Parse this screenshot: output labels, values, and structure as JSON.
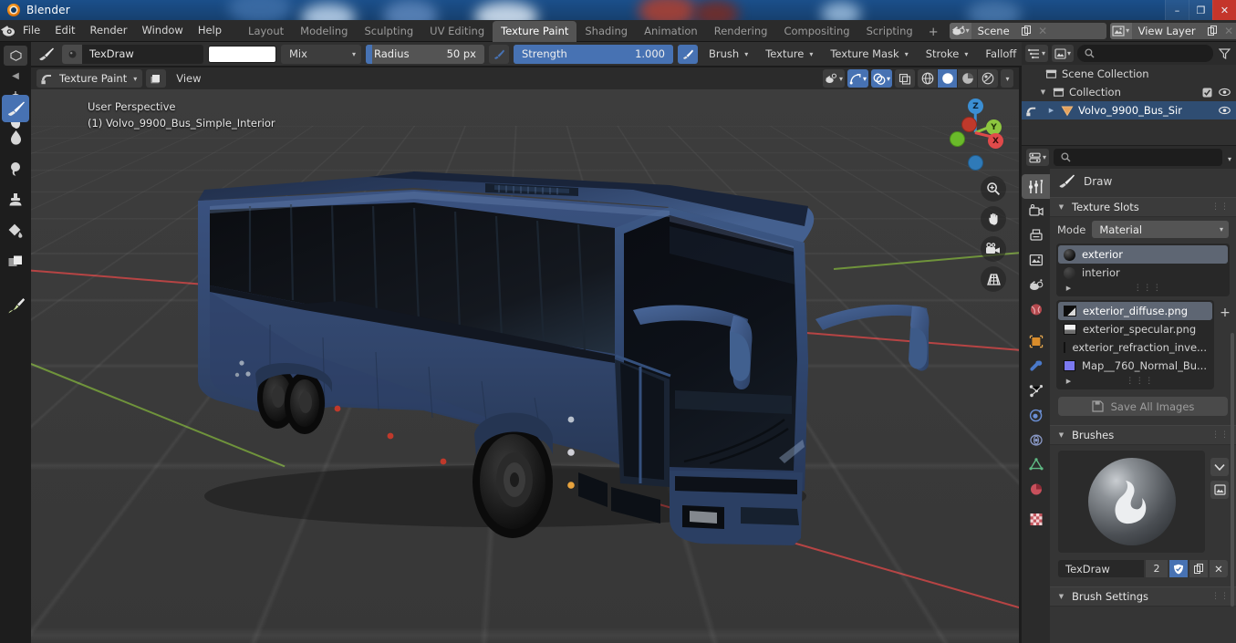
{
  "window": {
    "app_title": "Blender",
    "minimize": "–",
    "maximize": "❐",
    "close": "✕"
  },
  "topbar": {
    "logo_icon": "blender-logo-icon",
    "menus": [
      "File",
      "Edit",
      "Render",
      "Window",
      "Help"
    ],
    "workspaces": [
      {
        "label": "Layout",
        "active": false
      },
      {
        "label": "Modeling",
        "active": false
      },
      {
        "label": "Sculpting",
        "active": false
      },
      {
        "label": "UV Editing",
        "active": false
      },
      {
        "label": "Texture Paint",
        "active": true
      },
      {
        "label": "Shading",
        "active": false
      },
      {
        "label": "Animation",
        "active": false
      },
      {
        "label": "Rendering",
        "active": false
      },
      {
        "label": "Compositing",
        "active": false
      },
      {
        "label": "Scripting",
        "active": false
      }
    ],
    "add_workspace": "+",
    "scene": {
      "icon": "scene-icon",
      "name": "Scene",
      "new_icon": "copy-icon",
      "unlink_icon": "✕"
    },
    "view_layer": {
      "icon": "view-layer-icon",
      "name": "View Layer",
      "new_icon": "copy-icon",
      "unlink_icon": "✕"
    }
  },
  "tool_settings": {
    "editor_type_icon": "texture-paint-editor-icon",
    "brush_icon": "brush-icon",
    "brush_name": "TexDraw",
    "color_swatch": "#ffffff",
    "blend_mode": "Mix",
    "radius": {
      "label": "Radius",
      "value": "50 px",
      "fill_pct": 4,
      "pressure_icon": "pressure-icon"
    },
    "strength": {
      "label": "Strength",
      "value": "1.000",
      "fill_pct": 100,
      "pressure_icon": "pressure-icon"
    },
    "menus": [
      "Brush",
      "Texture",
      "Texture Mask",
      "Stroke",
      "Falloff"
    ]
  },
  "viewport_header": {
    "mode_icon": "texture-paint-mode-icon",
    "mode": "Texture Paint",
    "object_icon": "object-icon",
    "view_menu": "View",
    "right_buttons": [
      {
        "name": "visibility-icon",
        "active": false
      },
      {
        "name": "gizmo-icon",
        "active": true
      },
      {
        "name": "overlays-icon",
        "active": true
      },
      {
        "name": "xray-icon",
        "active": false
      },
      {
        "name": "shading-wireframe-icon",
        "active": false
      },
      {
        "name": "shading-solid-icon",
        "active": true
      },
      {
        "name": "shading-material-icon",
        "active": false
      },
      {
        "name": "shading-rendered-icon",
        "active": false
      }
    ]
  },
  "toolshelf": {
    "tools": [
      {
        "name": "tool-draw",
        "active": true
      },
      {
        "name": "tool-soften",
        "active": false
      },
      {
        "name": "tool-smear",
        "active": false
      },
      {
        "name": "tool-clone",
        "active": false
      },
      {
        "name": "tool-fill",
        "active": false
      },
      {
        "name": "tool-mask",
        "active": false
      },
      {
        "name": "tool-annotate",
        "active": false
      }
    ]
  },
  "viewport": {
    "overlay_line1": "User Perspective",
    "overlay_line2": "(1) Volvo_9900_Bus_Simple_Interior",
    "gizmo": {
      "axis_x": "X",
      "axis_y": "Y",
      "axis_z": "Z",
      "color_x": "#e04a4a",
      "color_y": "#8dc63f",
      "color_z": "#3b8fd4"
    },
    "nav_buttons": [
      {
        "name": "zoom-icon",
        "glyph": "⌕"
      },
      {
        "name": "pan-hand-icon",
        "glyph": "✋"
      },
      {
        "name": "camera-view-icon",
        "glyph": "🎥"
      },
      {
        "name": "toggle-perspective-icon",
        "glyph": "▦"
      }
    ],
    "model_color": "#33496e"
  },
  "outliner": {
    "display_mode_icon": "outliner-display-mode-icon",
    "filter_id_icon": "id-type-icon",
    "search_placeholder": "",
    "filter_icon": "filter-icon",
    "rows": [
      {
        "label": "Scene Collection",
        "icon": "collection-icon",
        "indent": 0,
        "selected": false,
        "has_tri": false,
        "checkbox": false,
        "eye": false
      },
      {
        "label": "Collection",
        "icon": "collection-icon",
        "indent": 1,
        "selected": false,
        "has_tri": true,
        "checkbox": true,
        "eye": true
      },
      {
        "label": "Volvo_9900_Bus_Sir",
        "icon": "mesh-object-icon",
        "indent": 2,
        "selected": true,
        "has_tri": true,
        "checkbox": false,
        "eye": true
      }
    ]
  },
  "properties": {
    "editor_icon": "properties-editor-icon",
    "search_placeholder": "",
    "tabs": [
      {
        "name": "tab-tool",
        "active": true
      },
      {
        "name": "tab-render",
        "active": false
      },
      {
        "name": "tab-output",
        "active": false
      },
      {
        "name": "tab-view-layer",
        "active": false
      },
      {
        "name": "tab-scene",
        "active": false
      },
      {
        "name": "tab-world",
        "active": false
      },
      {
        "name": "tab-object",
        "active": false
      },
      {
        "name": "tab-modifiers",
        "active": false
      },
      {
        "name": "tab-particles",
        "active": false
      },
      {
        "name": "tab-physics",
        "active": false
      },
      {
        "name": "tab-constraints",
        "active": false
      },
      {
        "name": "tab-object-data",
        "active": false
      },
      {
        "name": "tab-material",
        "active": false
      },
      {
        "name": "tab-texture",
        "active": false
      }
    ],
    "tool_title": {
      "icon": "brush-icon",
      "label": "Draw"
    },
    "texture_slots": {
      "panel_label": "Texture Slots",
      "mode_label": "Mode",
      "mode_value": "Material",
      "materials": [
        {
          "label": "exterior",
          "selected": true
        },
        {
          "label": "interior",
          "selected": false
        }
      ],
      "textures": [
        {
          "label": "exterior_diffuse.png",
          "selected": true,
          "swatch": "#0b0b0b"
        },
        {
          "label": "exterior_specular.png",
          "selected": false,
          "swatch": "#e8e8e8"
        },
        {
          "label": "exterior_refraction_inve...",
          "selected": false,
          "swatch": "#6f6f8a"
        },
        {
          "label": "Map__760_Normal_Bu...",
          "selected": false,
          "swatch": "#7b79f0"
        }
      ],
      "add_texture": "+",
      "save_all_label": "Save All Images",
      "save_all_icon": "save-icon"
    },
    "brushes": {
      "panel_label": "Brushes",
      "preview_icon": "brush-stroke-preview",
      "side_buttons": [
        {
          "name": "brush-preset-dropdown-icon",
          "glyph": "⌄"
        },
        {
          "name": "brush-new-image-icon",
          "glyph": "⛰"
        }
      ],
      "brush_name": "TexDraw",
      "users_count": "2",
      "fake_user_icon": "shield-icon",
      "duplicate_icon": "copy-icon",
      "unlink_icon": "✕"
    },
    "brush_settings": {
      "panel_label": "Brush Settings"
    }
  }
}
